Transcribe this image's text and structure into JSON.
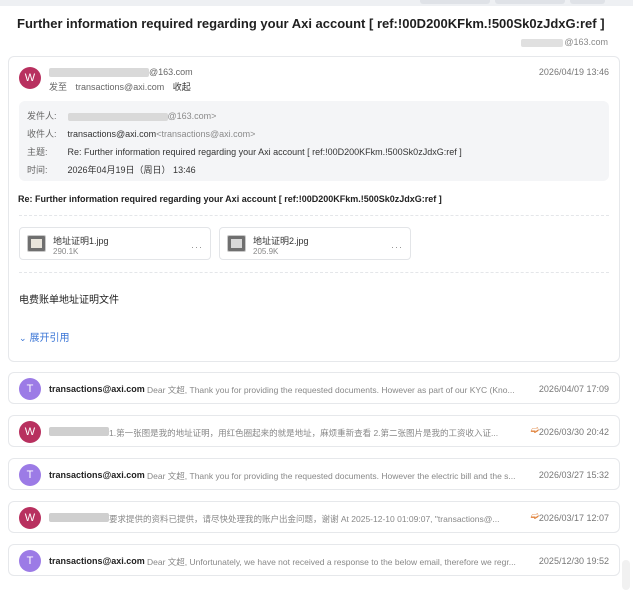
{
  "email": {
    "subject": "Further information required regarding your Axi account [ ref:!00D200KFkm.!500Sk0zJdxG:ref ]",
    "recipient_suffix": "@163.com",
    "sender_suffix": "@163.com",
    "to_label": "发至",
    "to_addr": "transactions@axi.com",
    "collapse_label": "收起",
    "date": "2026/04/19 13:46",
    "meta": {
      "from_label": "发件人:",
      "from_value": "@163.com>",
      "to_label": "收件人:",
      "to_value": "transactions@axi.com",
      "to_value_full": "<transactions@axi.com>",
      "subject_label": "主题:",
      "subject_value": "Re: Further information required regarding your Axi account [ ref:!00D200KFkm.!500Sk0zJdxG:ref ]",
      "time_label": "时间:",
      "time_value": "2026年04月19日（周日） 13:46"
    },
    "reply_title": "Re: Further information required regarding your Axi account [ ref:!00D200KFkm.!500Sk0zJdxG:ref ]",
    "attachments": [
      {
        "name": "地址证明1.jpg",
        "size": "290.1K",
        "more": "···"
      },
      {
        "name": "地址证明2.jpg",
        "size": "205.9K",
        "more": "···"
      }
    ],
    "body": "电费账单地址证明文件",
    "expand_label": "展开引用",
    "avatar_letter": "W"
  },
  "threads": [
    {
      "avatar": "T",
      "sender": "transactions@axi.com",
      "preview": "Dear 文超, Thank you for providing the requested documents. However as part of our KYC (Kno...",
      "date": "2026/04/07 17:09",
      "attachment": false
    },
    {
      "avatar": "W",
      "sender": "",
      "preview": "1.第一张图是我的地址证明，用红色圈起来的就是地址，麻烦重新查看 2.第二张图片是我的工资收入证...",
      "date": "2026/03/30 20:42",
      "attachment": true
    },
    {
      "avatar": "T",
      "sender": "transactions@axi.com",
      "preview": "Dear 文超, Thank you for providing the requested documents. However the electric bill and the s...",
      "date": "2026/03/27 15:32",
      "attachment": false
    },
    {
      "avatar": "W",
      "sender": "",
      "preview": "要求提供的资料已提供，请尽快处理我的账户出金问题，谢谢 At 2025-12-10 01:09:07, \"transactions@...",
      "date": "2026/03/17 12:07",
      "attachment": true
    },
    {
      "avatar": "T",
      "sender": "transactions@axi.com",
      "preview": "Dear 文超, Unfortunately, we have not received a response to the below email, therefore we regr...",
      "date": "2025/12/30 19:52",
      "attachment": false
    }
  ],
  "icons": {
    "attachment": "paperclip-icon",
    "expand": "chevron-down-icon"
  }
}
